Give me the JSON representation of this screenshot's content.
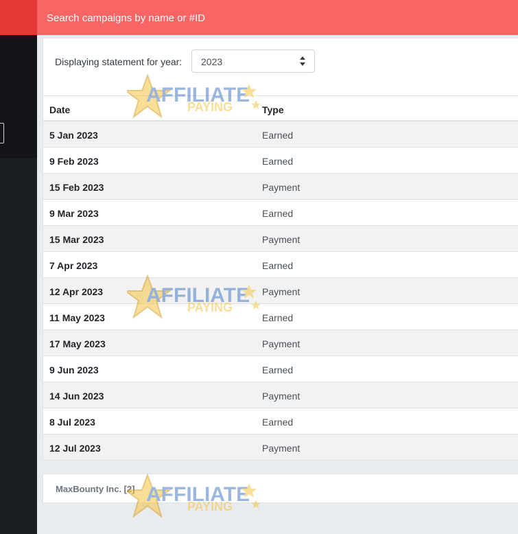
{
  "header": {
    "search_placeholder": "Search campaigns by name or #ID"
  },
  "filter": {
    "label": "Displaying statement for year:",
    "selected_year": "2023"
  },
  "table": {
    "columns": [
      "Date",
      "Type"
    ],
    "rows": [
      {
        "date": "5 Jan 2023",
        "type": "Earned"
      },
      {
        "date": "9 Feb 2023",
        "type": "Earned"
      },
      {
        "date": "15 Feb 2023",
        "type": "Payment"
      },
      {
        "date": "9 Mar 2023",
        "type": "Earned"
      },
      {
        "date": "15 Mar 2023",
        "type": "Payment"
      },
      {
        "date": "7 Apr 2023",
        "type": "Earned"
      },
      {
        "date": "12 Apr 2023",
        "type": "Payment"
      },
      {
        "date": "11 May 2023",
        "type": "Earned"
      },
      {
        "date": "17 May 2023",
        "type": "Payment"
      },
      {
        "date": "9 Jun 2023",
        "type": "Earned"
      },
      {
        "date": "14 Jun 2023",
        "type": "Payment"
      },
      {
        "date": "8 Jul 2023",
        "type": "Earned"
      },
      {
        "date": "12 Jul 2023",
        "type": "Payment"
      }
    ]
  },
  "footer": {
    "company": "MaxBounty Inc. [2]"
  },
  "watermark": {
    "line1": "AFFILIATE",
    "line2": "PAYING"
  },
  "colors": {
    "topbar": "#f96464",
    "topbar_left": "#e53935",
    "sidebar": "#1b1e22"
  },
  "icons": {
    "select_arrows": "sort-arrows-icon",
    "sidebar_toggle": "panel-toggle-icon",
    "watermark_logo": "star-logo-icon"
  }
}
